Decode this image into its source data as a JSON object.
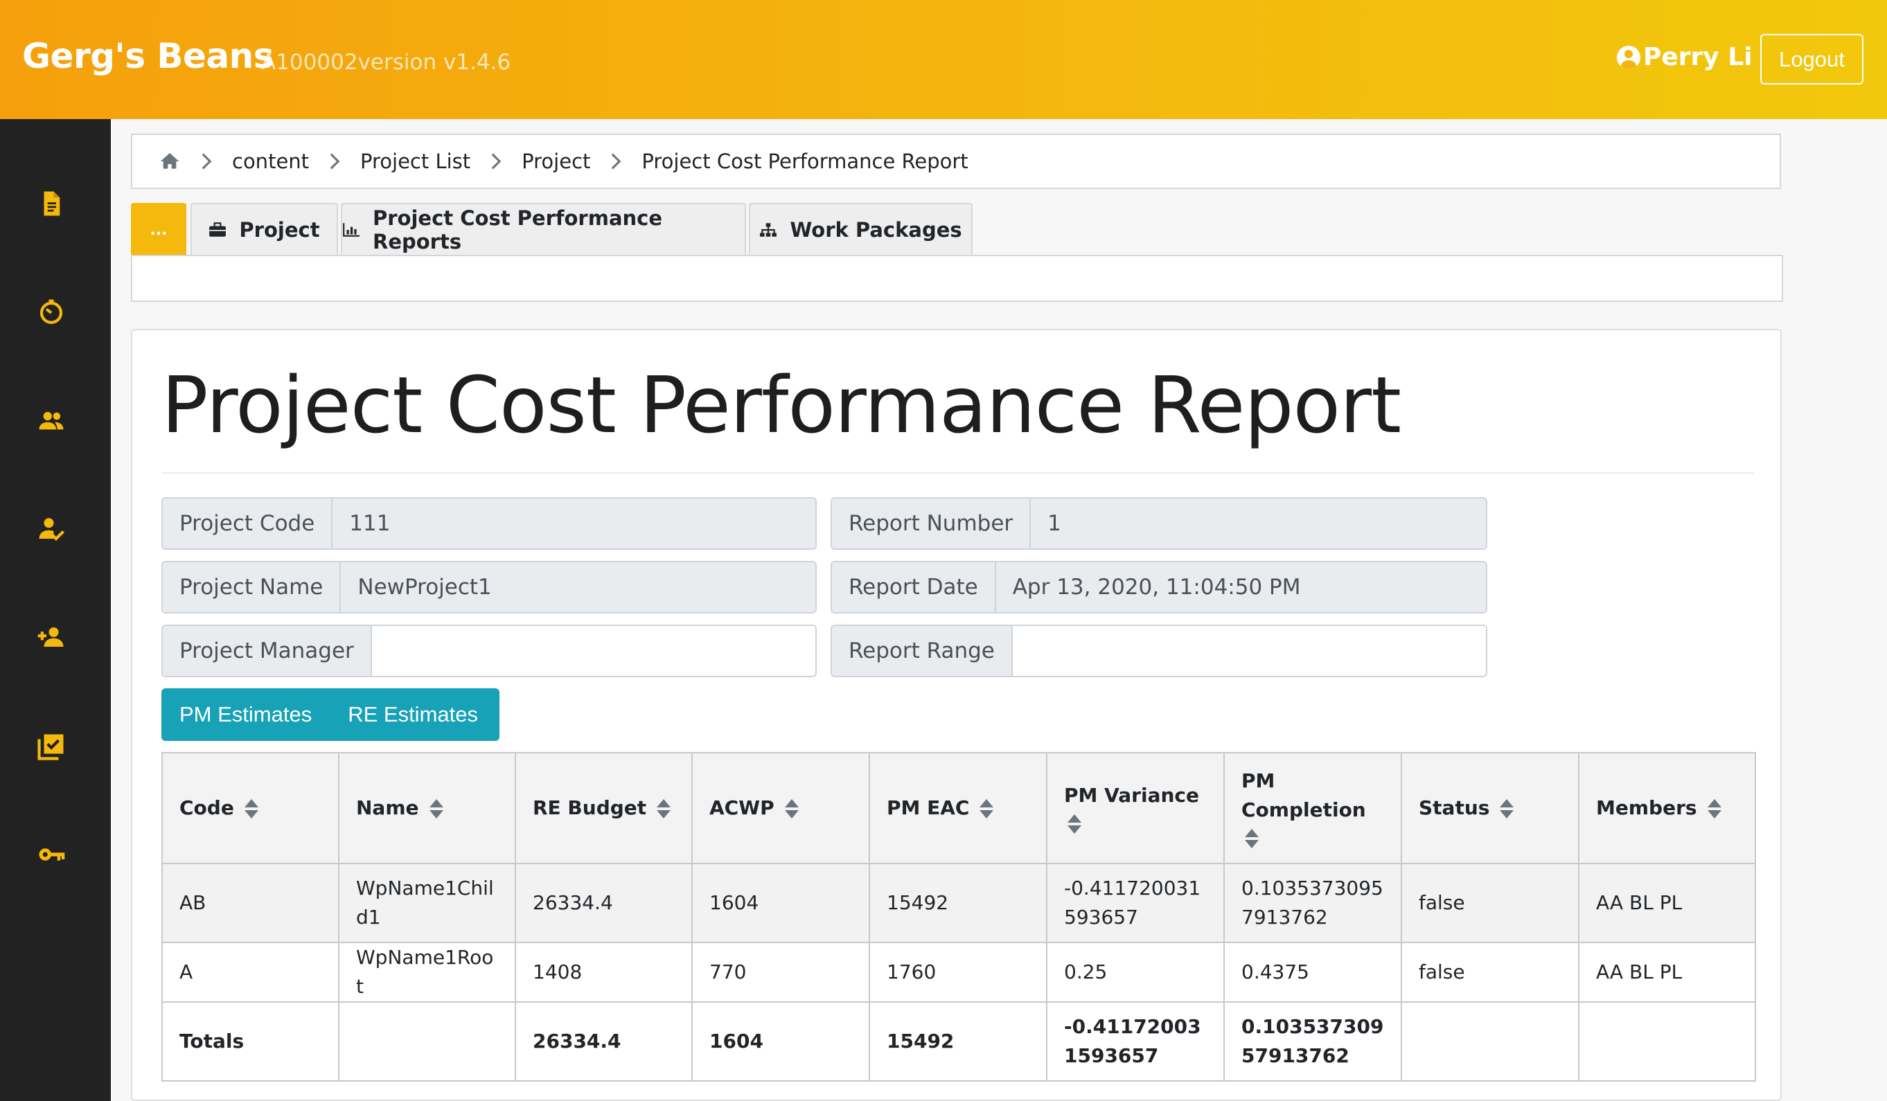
{
  "header": {
    "brand": "Gerg's Beans",
    "version": "A100002version v1.4.6",
    "user_name": "Perry Li",
    "logout_label": "Logout"
  },
  "sidebar": {
    "items": [
      {
        "icon": "document-icon"
      },
      {
        "icon": "timer-icon"
      },
      {
        "icon": "users-icon"
      },
      {
        "icon": "user-check-icon"
      },
      {
        "icon": "user-plus-icon"
      },
      {
        "icon": "checklist-icon"
      },
      {
        "icon": "key-icon"
      }
    ]
  },
  "breadcrumb": {
    "items": [
      "content",
      "Project List",
      "Project",
      "Project Cost Performance Report"
    ]
  },
  "tabs": {
    "more_label": "...",
    "items": [
      {
        "label": "Project",
        "icon": "briefcase-icon"
      },
      {
        "label": "Project Cost Performance Reports",
        "icon": "bar-chart-icon"
      },
      {
        "label": "Work Packages",
        "icon": "sitemap-icon"
      }
    ]
  },
  "report": {
    "title": "Project Cost Performance Report",
    "fields": {
      "project_code": {
        "label": "Project Code",
        "value": "111"
      },
      "project_name": {
        "label": "Project Name",
        "value": "NewProject1"
      },
      "project_manager": {
        "label": "Project Manager",
        "value": ""
      },
      "report_number": {
        "label": "Report Number",
        "value": "1"
      },
      "report_date": {
        "label": "Report Date",
        "value": "Apr 13, 2020, 11:04:50 PM"
      },
      "report_range": {
        "label": "Report Range",
        "value": ""
      }
    },
    "estimate_buttons": {
      "pm": "PM Estimates",
      "re": "RE Estimates"
    }
  },
  "table": {
    "columns": [
      "Code",
      "Name",
      "RE Budget",
      "ACWP",
      "PM EAC",
      "PM Variance",
      "PM Completion",
      "Status",
      "Members"
    ],
    "rows": [
      [
        "AB",
        "WpName1Child1",
        "26334.4",
        "1604",
        "15492",
        "-0.411720031593657",
        "0.10353730957913762",
        "false",
        "AA BL PL"
      ],
      [
        "A",
        "WpName1Root",
        "1408",
        "770",
        "1760",
        "0.25",
        "0.4375",
        "false",
        "AA BL PL"
      ]
    ],
    "totals": [
      "Totals",
      "",
      "26334.4",
      "1604",
      "15492",
      "-0.411720031593657",
      "0.10353730957913762",
      "",
      ""
    ]
  },
  "colors": {
    "header_gradient_start": "#f5a00c",
    "header_gradient_end": "#f2c80c",
    "accent_yellow": "#f5b80c",
    "sidebar_bg": "#222222",
    "estimates_teal": "#17a2b8"
  }
}
